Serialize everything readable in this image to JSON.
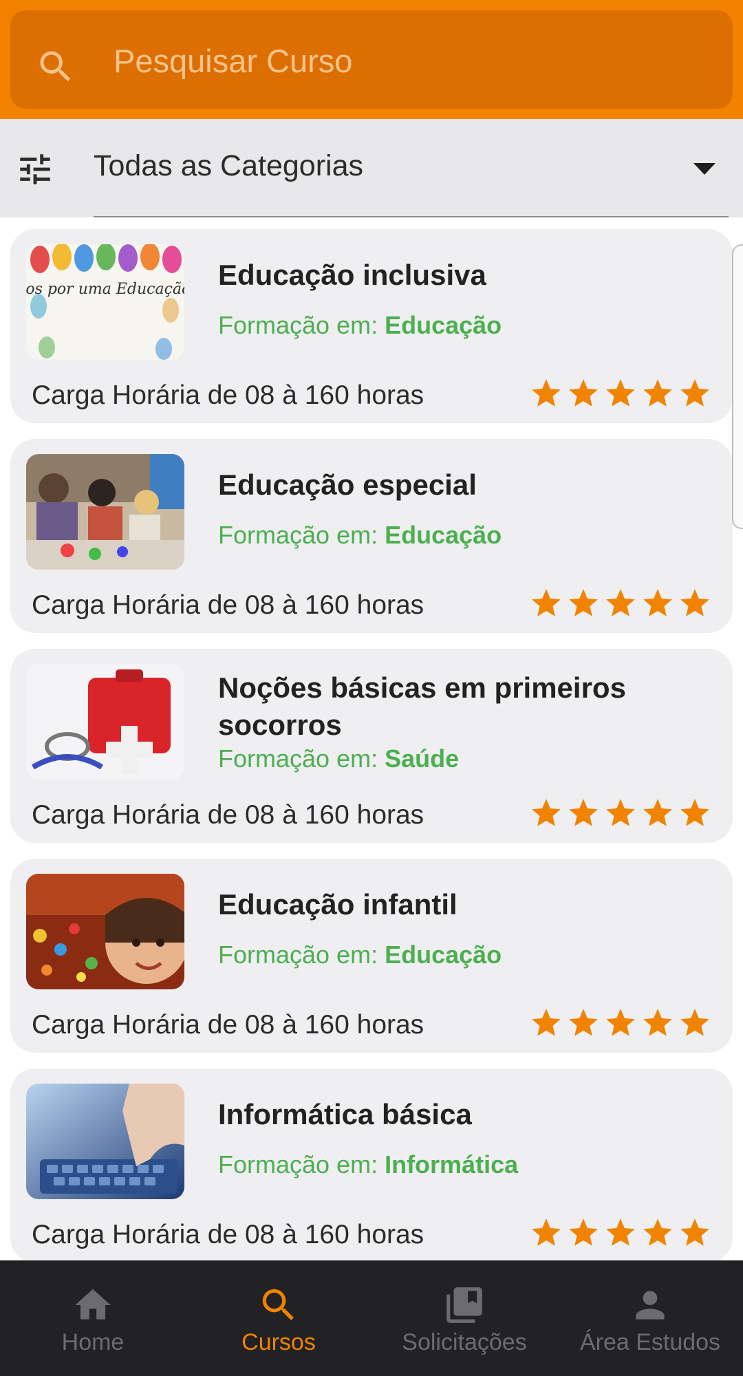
{
  "search": {
    "placeholder": "Pesquisar Curso",
    "icon": "search-icon"
  },
  "filter": {
    "icon": "tune-icon",
    "selected": "Todas as Categorias",
    "dropdown_icon": "caret-down-icon"
  },
  "courses": [
    {
      "title": "Educação inclusiva",
      "subtitle_prefix": "Formação em: ",
      "category": "Educação",
      "hours": "Carga Horária de 08 à 160 horas",
      "rating": 5,
      "image_text": "Todos juntos por uma Educação Inclusiva"
    },
    {
      "title": "Educação especial",
      "subtitle_prefix": "Formação em: ",
      "category": "Educação",
      "hours": "Carga Horária de 08 à 160 horas",
      "rating": 5
    },
    {
      "title": "Noções básicas em primeiros socorros",
      "subtitle_prefix": "Formação em: ",
      "category": "Saúde",
      "hours": "Carga Horária de 08 à 160 horas",
      "rating": 5
    },
    {
      "title": "Educação infantil",
      "subtitle_prefix": "Formação em: ",
      "category": "Educação",
      "hours": "Carga Horária de 08 à 160 horas",
      "rating": 5
    },
    {
      "title": "Informática básica",
      "subtitle_prefix": "Formação em: ",
      "category": "Informática",
      "hours": "Carga Horária de 08 à 160 horas",
      "rating": 5
    }
  ],
  "nav": {
    "items": [
      {
        "label": "Home",
        "icon": "home-icon",
        "active": false
      },
      {
        "label": "Cursos",
        "icon": "search-icon",
        "active": true
      },
      {
        "label": "Solicitações",
        "icon": "library-books-icon",
        "active": false
      },
      {
        "label": "Área Estudos",
        "icon": "person-icon",
        "active": false
      }
    ]
  },
  "colors": {
    "header": "#f28200",
    "search_box": "#dd6f02",
    "accent_green": "#4caf50",
    "star": "#f08400",
    "nav_bg": "#222124",
    "nav_active": "#f08400",
    "nav_inactive": "#6c6b70"
  }
}
